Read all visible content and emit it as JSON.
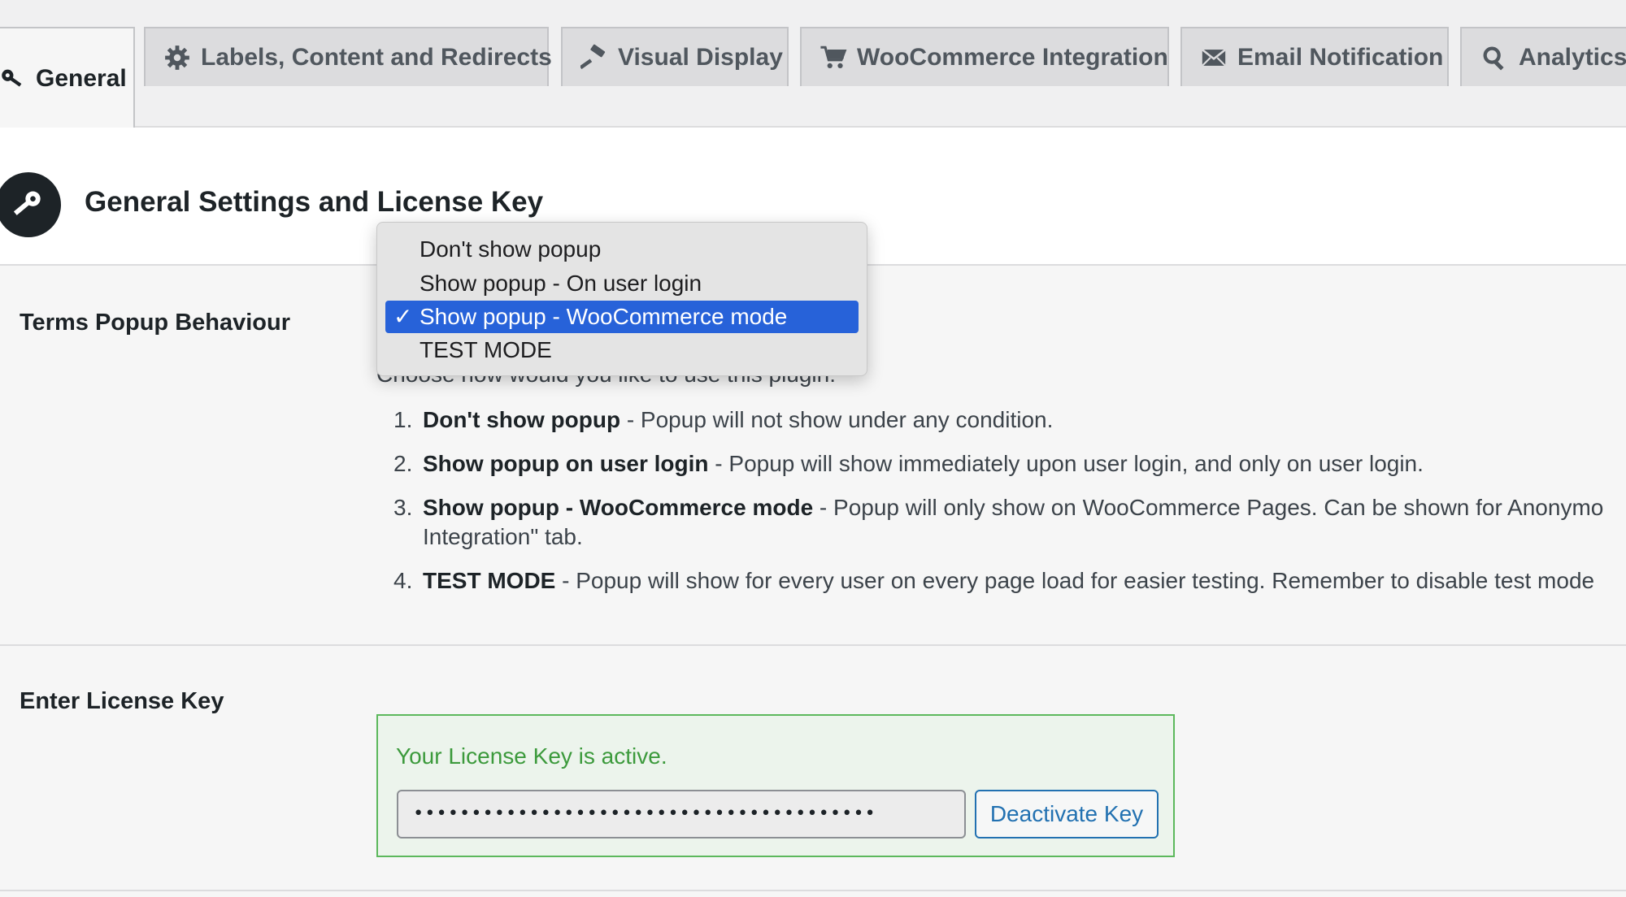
{
  "tabs": [
    {
      "label": "General",
      "icon": "key-icon",
      "active": true
    },
    {
      "label": "Labels, Content and Redirects",
      "icon": "gear-icon",
      "active": false
    },
    {
      "label": "Visual Display",
      "icon": "hammer-icon",
      "active": false
    },
    {
      "label": "WooCommerce Integration",
      "icon": "cart-icon",
      "active": false
    },
    {
      "label": "Email Notification",
      "icon": "envelope-icon",
      "active": false
    },
    {
      "label": "Analytics",
      "icon": "search-icon",
      "active": false
    }
  ],
  "header": {
    "title": "General Settings and License Key",
    "icon": "key-icon"
  },
  "popup_behaviour": {
    "label": "Terms Popup Behaviour",
    "description": "Choose how would you like to use this plugin:",
    "dropdown": {
      "selected_index": 2,
      "check_mark": "✓",
      "options": [
        "Don't show popup",
        "Show popup - On user login",
        "Show popup - WooCommerce mode",
        "TEST MODE"
      ]
    },
    "options_explained": [
      {
        "num": "1.",
        "title": "Don't show popup",
        "text": " - Popup will not show under any condition."
      },
      {
        "num": "2.",
        "title": "Show popup on user login",
        "text": " - Popup will show immediately upon user login, and only on user login."
      },
      {
        "num": "3.",
        "title": "Show popup - WooCommerce mode",
        "text": " - Popup will only show on WooCommerce Pages. Can be shown for Anonymo",
        "continuation": "Integration\" tab."
      },
      {
        "num": "4.",
        "title": "TEST MODE",
        "text": " - Popup will show for every user on every page load for easier testing. Remember to disable test mode"
      }
    ]
  },
  "license": {
    "label": "Enter License Key",
    "status": "Your License Key is active.",
    "masked_key": "••••••••••••••••••••••••••••••••••••••••",
    "deactivate_label": "Deactivate Key"
  },
  "colors": {
    "accent": "#2271b1",
    "selected_option": "#2762d9",
    "license_active_text": "#3c9a3c",
    "license_border": "#5cb85c"
  }
}
